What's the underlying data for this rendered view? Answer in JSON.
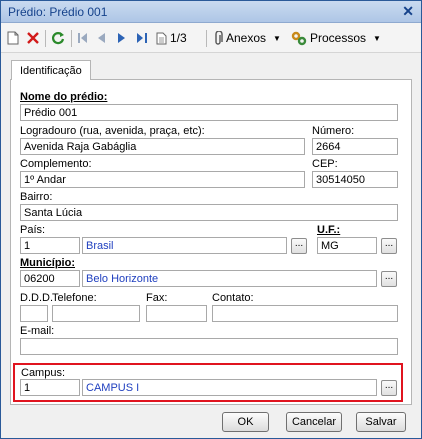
{
  "window": {
    "title": "Prédio: Prédio 001"
  },
  "toolbar": {
    "record_position": "1/3",
    "attachments_label": "Anexos",
    "processes_label": "Processos"
  },
  "tabs": [
    {
      "label": "Identificação"
    }
  ],
  "form": {
    "nome_label": "Nome do prédio:",
    "nome_value": "Prédio 001",
    "logradouro_label": "Logradouro (rua, avenida, praça, etc):",
    "logradouro_value": "Avenida Raja Gabáglia",
    "numero_label": "Número:",
    "numero_value": "2664",
    "complemento_label": "Complemento:",
    "complemento_value": "1º Andar",
    "cep_label": "CEP:",
    "cep_value": "30514050",
    "bairro_label": "Bairro:",
    "bairro_value": "Santa Lúcia",
    "pais_label": "País:",
    "pais_code": "1",
    "pais_name": "Brasil",
    "uf_label": "U.F.:",
    "uf_value": "MG",
    "municipio_label": "Município:",
    "municipio_code": "06200",
    "municipio_name": "Belo Horizonte",
    "ddd_label": "D.D.D.",
    "telefone_label": "Telefone:",
    "fax_label": "Fax:",
    "contato_label": "Contato:",
    "email_label": "E-mail:",
    "campus_label": "Campus:",
    "campus_code": "1",
    "campus_name": "CAMPUS I",
    "lookup_button": "..."
  },
  "buttons": {
    "ok": "OK",
    "cancel": "Cancelar",
    "save": "Salvar"
  },
  "colors": {
    "highlight": "#e0141f",
    "link_text": "#1f3fbf",
    "title_bar": "#c9daf0"
  }
}
